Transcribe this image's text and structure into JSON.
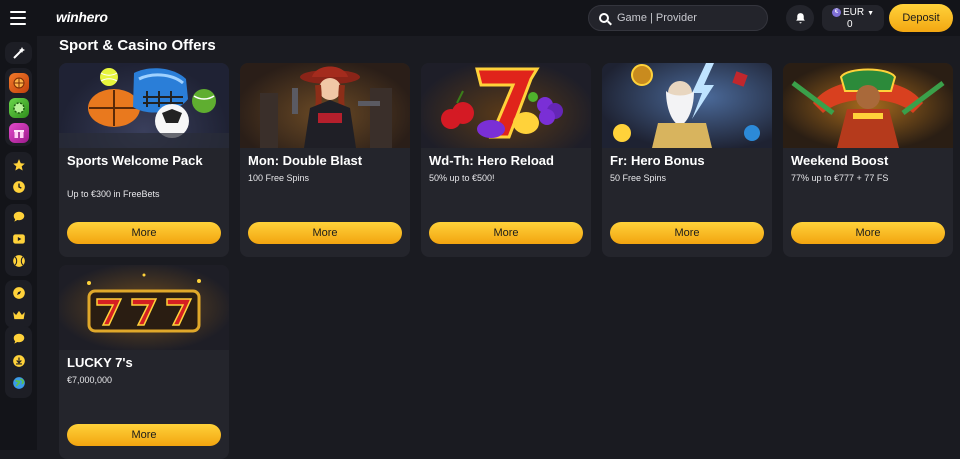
{
  "header": {
    "logo": "winhero",
    "search_placeholder": "Game | Provider",
    "currency": "EUR",
    "balance": "0",
    "deposit_label": "Deposit"
  },
  "sidebar": {
    "items": [
      {
        "icon": "magic-wand-icon"
      },
      {
        "icon": "sports-ball-icon"
      },
      {
        "icon": "chip-icon"
      },
      {
        "icon": "gift-box-icon"
      },
      {
        "icon": "star-icon"
      },
      {
        "icon": "clock-icon"
      },
      {
        "icon": "chat-bubble-icon"
      },
      {
        "icon": "play-icon"
      },
      {
        "icon": "tennis-ball-icon"
      },
      {
        "icon": "compass-icon"
      },
      {
        "icon": "crown-icon"
      },
      {
        "icon": "support-chat-icon"
      },
      {
        "icon": "download-icon"
      },
      {
        "icon": "globe-icon"
      }
    ]
  },
  "main": {
    "title": "Sport & Casino Offers",
    "offers": [
      {
        "name": "Sports Welcome Pack",
        "sub": "Up to €300 in FreeBets",
        "button": "More"
      },
      {
        "name": "Mon: Double Blast",
        "sub": "100 Free Spins",
        "button": "More"
      },
      {
        "name": "Wd-Th: Hero Reload",
        "sub": "50% up to €500!",
        "button": "More"
      },
      {
        "name": "Fr: Hero Bonus",
        "sub": "50 Free Spins",
        "button": "More"
      },
      {
        "name": "Weekend Boost",
        "sub": "77% up to €777 + 77 FS",
        "button": "More"
      },
      {
        "name": "LUCKY 7's",
        "sub": "€7,000,000",
        "button": "More"
      }
    ]
  },
  "colors": {
    "accent": "#ffc629",
    "background": "#1a1b21",
    "card": "#24252c"
  }
}
